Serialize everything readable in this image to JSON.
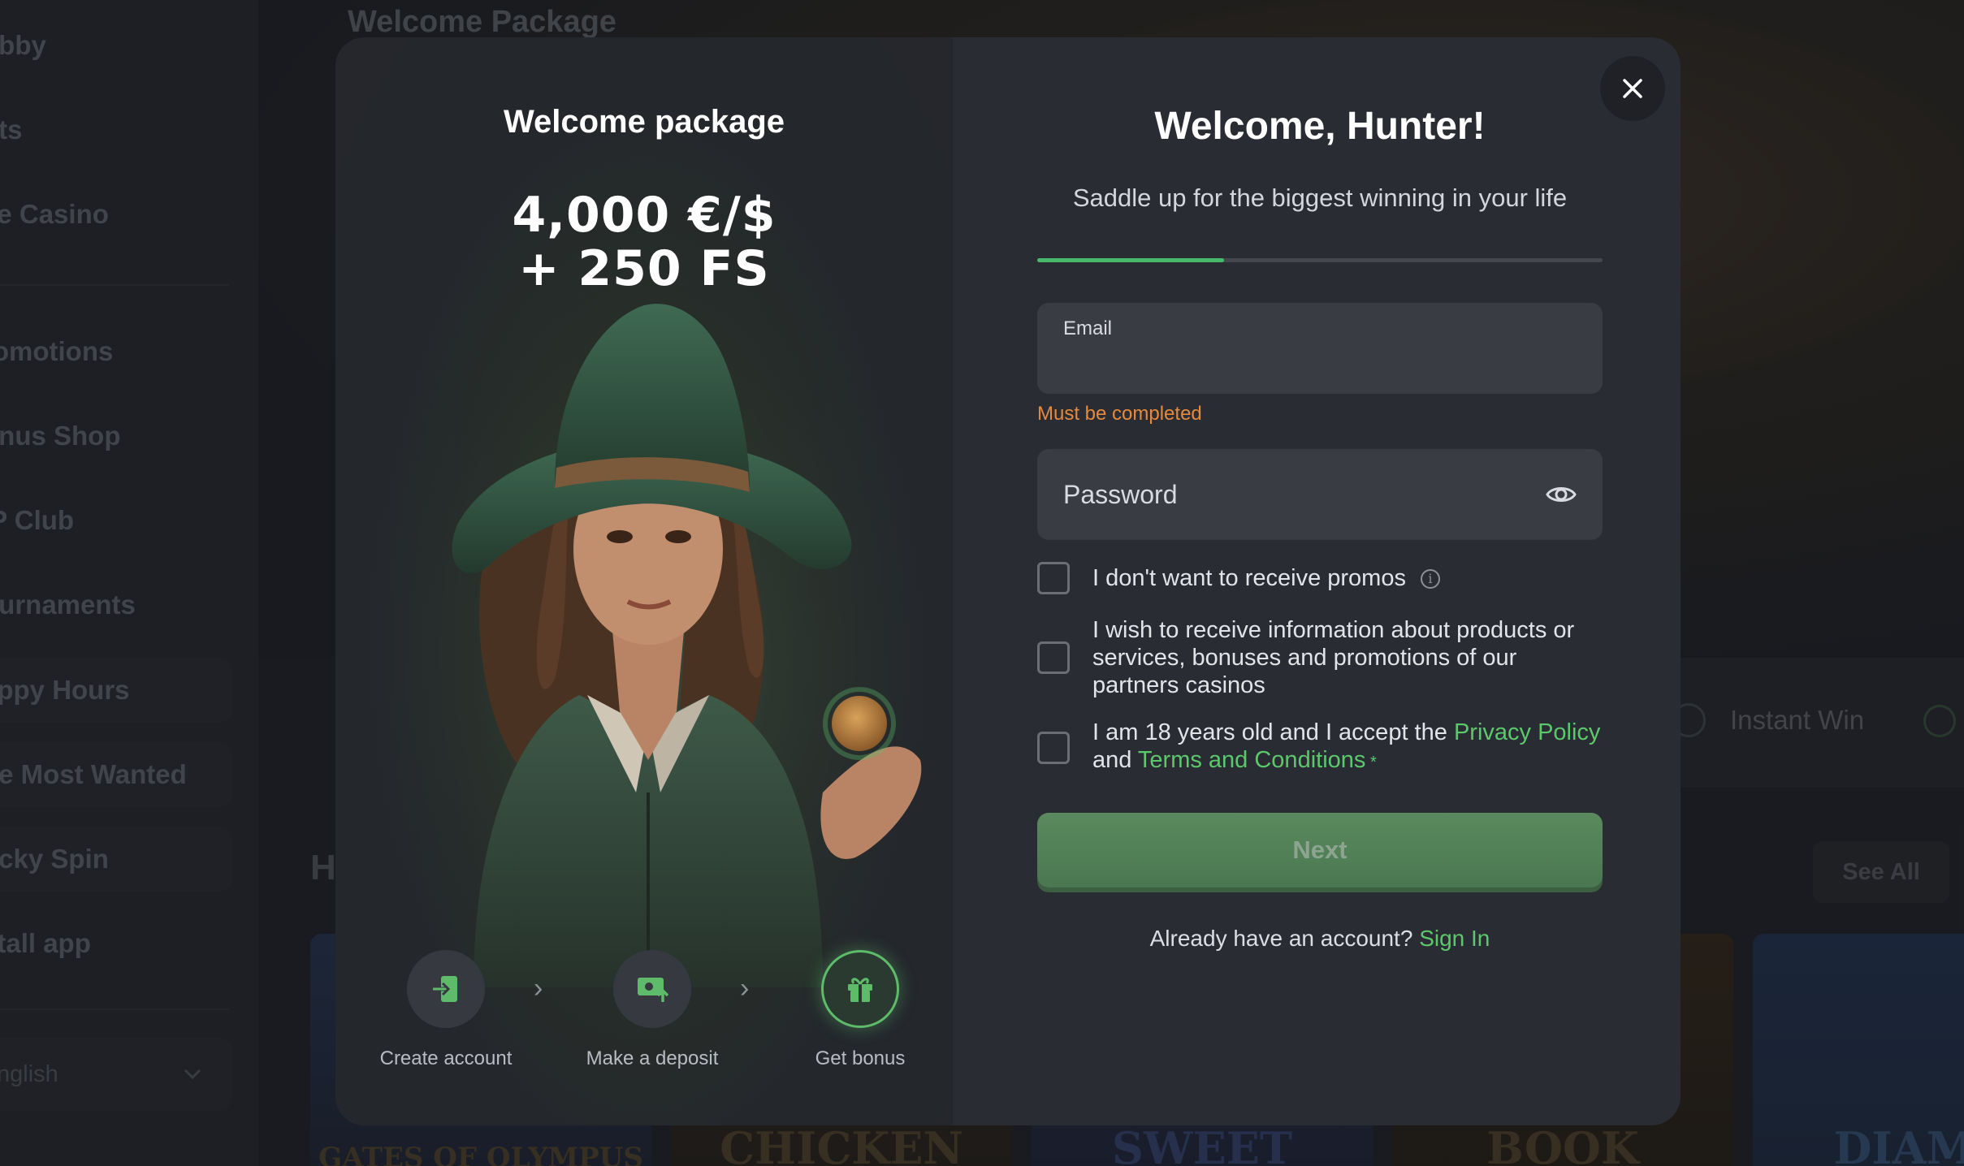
{
  "background": {
    "sidebar_items": [
      "obby",
      "ots",
      "ve Casino",
      "romotions",
      "onus Shop",
      "IP Club",
      "ournaments",
      "appy Hours",
      "he Most Wanted",
      "ucky Spin",
      "stall app"
    ],
    "language": "nglish",
    "hero_title": "Welcome Package",
    "category_instant_win": "Instant Win",
    "section_heading": "H",
    "see_all": "See All",
    "tiles": [
      "GATES OF OLYMPUS",
      "CHICKEN",
      "SWEET",
      "BOOK",
      "DIAMO"
    ]
  },
  "modal": {
    "promo": {
      "title": "Welcome package",
      "amount_line1": "4,000 €/$",
      "amount_line2": "+ 250 FS",
      "steps": [
        {
          "label": "Create account",
          "icon": "login-icon"
        },
        {
          "label": "Make a deposit",
          "icon": "deposit-icon"
        },
        {
          "label": "Get bonus",
          "icon": "gift-icon"
        }
      ]
    },
    "form": {
      "title": "Welcome, Hunter!",
      "subtitle": "Saddle up for the biggest winning in your life",
      "progress": 0.33,
      "email_label": "Email",
      "email_value": "",
      "email_error": "Must be completed",
      "password_placeholder": "Password",
      "checkbox_promos": "I don't want to receive promos",
      "checkbox_partners": "I wish to receive information about products or services, bonuses and promotions of our partners casinos",
      "checkbox_age_prefix": "I am 18 years old and I accept the ",
      "privacy_policy": "Privacy Policy",
      "and_text": "and ",
      "terms": "Terms and Conditions",
      "required_mark": " *",
      "next_button": "Next",
      "signin_prompt": "Already have an account? ",
      "signin_link": "Sign In"
    }
  },
  "colors": {
    "accent_green": "#5cc86c",
    "error_orange": "#e58a3c",
    "modal_bg": "#2a2c33"
  }
}
